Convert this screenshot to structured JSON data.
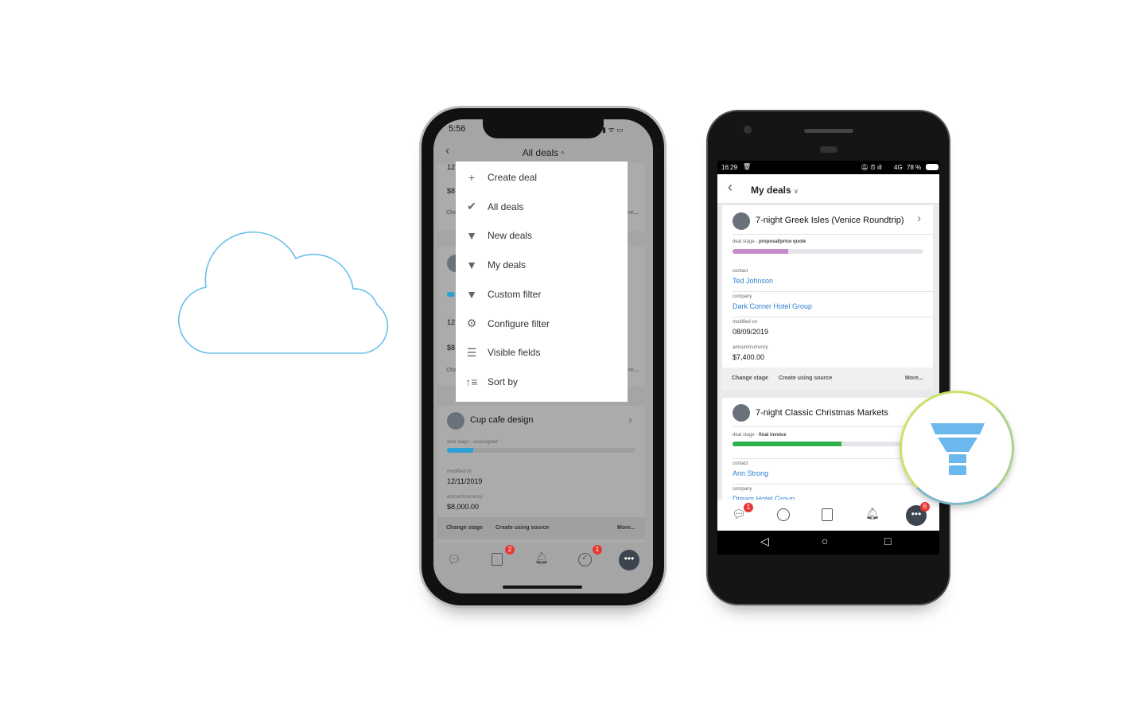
{
  "colors": {
    "cloud": "#6cc0ea",
    "funnel": "#6ab8ee",
    "magnifier_ring": "#c9e26a",
    "stage_purple": "#c58ac8",
    "stage_green": "#2fb04a",
    "stage_blue": "#2aa0d4",
    "badge": "#e53935"
  },
  "iphone": {
    "status": {
      "time": "5:56"
    },
    "header": {
      "title": "All deals"
    },
    "background_fragments": {
      "a": "12",
      "b": "$8",
      "c": "Cha",
      "d": "re...",
      "e": "12",
      "f": "$8",
      "g": "Cha",
      "h": "re..."
    },
    "menu": [
      {
        "icon": "plus-icon",
        "label": "Create deal"
      },
      {
        "icon": "check-icon",
        "label": "All deals"
      },
      {
        "icon": "filter-icon",
        "label": "New deals"
      },
      {
        "icon": "filter-icon",
        "label": "My deals"
      },
      {
        "icon": "filter-icon",
        "label": "Custom filter"
      },
      {
        "icon": "gear-icon",
        "label": "Configure filter"
      },
      {
        "icon": "rows-icon",
        "label": "Visible fields"
      },
      {
        "icon": "sort-icon",
        "label": "Sort by"
      }
    ],
    "card": {
      "title": "Cup cafe design",
      "stage_label": "deal stage - unassigned",
      "stage_progress": 0.14,
      "modified_label": "modified on",
      "modified": "12/11/2019",
      "amount_label": "amount/currency",
      "amount": "$8,000.00",
      "actions": [
        "Change stage",
        "Create using source",
        "More..."
      ]
    },
    "nav_badges": {
      "documents": "2",
      "tasks": "1"
    }
  },
  "android": {
    "status": {
      "time": "16:29",
      "network": "4G",
      "battery": "78 %"
    },
    "header": {
      "title": "My deals"
    },
    "cards": [
      {
        "title": "7-night Greek Isles (Venice Roundtrip)",
        "stage_prefix": "deal stage - ",
        "stage": "proposal/price quote",
        "stage_progress": 0.29,
        "contact_label": "contact",
        "contact": "Ted Johnson",
        "company_label": "company",
        "company": "Dark Corner Hotel Group",
        "modified_label": "modified on",
        "modified": "08/09/2019",
        "amount_label": "amount/currency",
        "amount": "$7,400.00",
        "actions": [
          "Change stage",
          "Create using source",
          "More..."
        ]
      },
      {
        "title": "7-night Classic Christmas Markets",
        "stage_prefix": "deal stage - ",
        "stage": "final invoice",
        "stage_progress": 0.57,
        "contact_label": "contact",
        "contact": "Ann Strong",
        "company_label": "company",
        "company": "Dream Hotel Group"
      }
    ],
    "nav_badges": {
      "chat": "1",
      "more": "6"
    }
  }
}
